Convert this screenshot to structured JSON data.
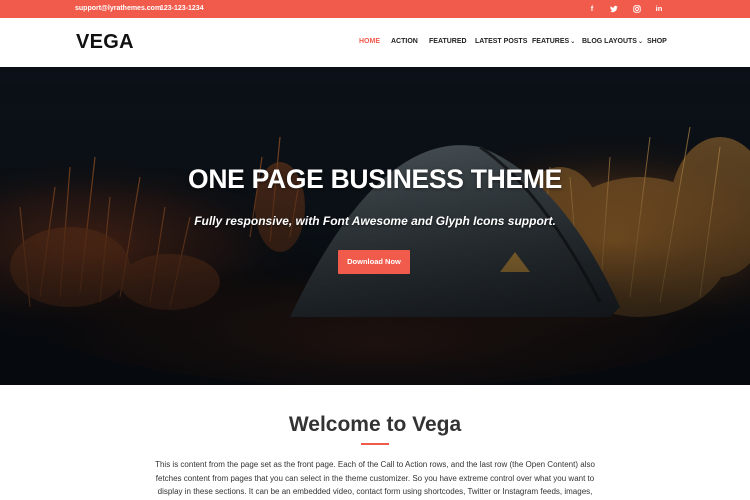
{
  "topbar": {
    "email": "support@lyrathemes.com",
    "phone": "123-123-1234",
    "social": [
      {
        "icon": "facebook-icon",
        "glyph": "f"
      },
      {
        "icon": "twitter-icon",
        "glyph": ""
      },
      {
        "icon": "instagram-icon",
        "glyph": ""
      },
      {
        "icon": "linkedin-icon",
        "glyph": "in"
      }
    ],
    "color": "#f15b4c"
  },
  "header": {
    "logo": "VEGA",
    "nav": [
      {
        "label": "HOME",
        "active": true
      },
      {
        "label": "ACTION"
      },
      {
        "label": "FEATURED"
      },
      {
        "label": "LATEST POSTS"
      },
      {
        "label": "FEATURES",
        "dropdown": true
      },
      {
        "label": "BLOG LAYOUTS",
        "dropdown": true
      },
      {
        "label": "SHOP"
      }
    ],
    "active_color": "#f15b4c"
  },
  "hero": {
    "title": "ONE PAGE BUSINESS THEME",
    "subtitle": "Fully responsive, with Font Awesome and Glyph Icons support.",
    "button": "Download Now",
    "background": "tent-in-desert-at-dusk"
  },
  "welcome": {
    "title": "Welcome to Vega",
    "text": "This is content from the page set as the front page. Each of the Call to Action rows, and the last row (the Open Content) also fetches content from pages that you can select in the theme customizer. So you have extreme control over what you want to display in these sections. It can be an embedded video, contact form using shortcodes, Twitter or Instagram feeds, images, galleries – the possibilities are"
  }
}
